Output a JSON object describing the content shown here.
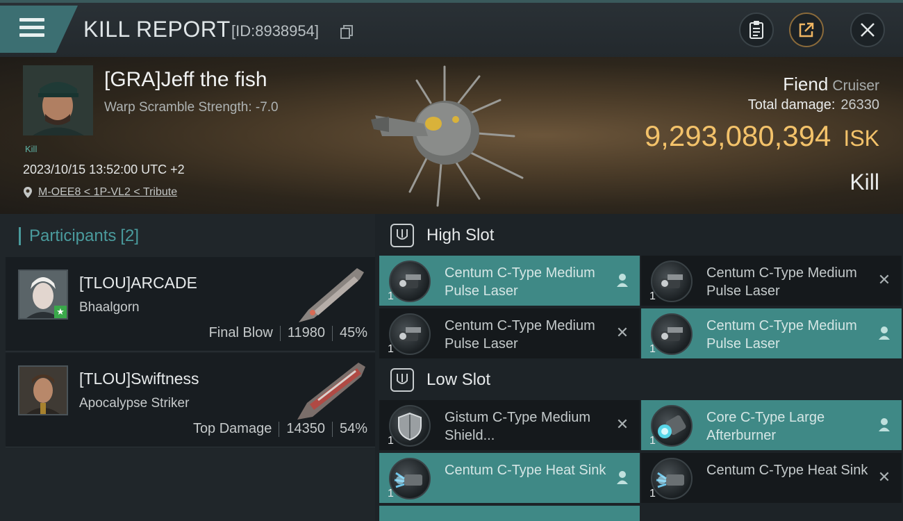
{
  "header": {
    "title": "KILL REPORT",
    "report_id": "[ID:8938954]"
  },
  "victim": {
    "name": "[GRA]Jeff the fish",
    "warp_scramble": "Warp Scramble Strength: -7.0",
    "tag": "Kill",
    "datetime": "2023/10/15 13:52:00 UTC +2",
    "location": "M-OEE8 < 1P-VL2 < Tribute"
  },
  "ship": {
    "name": "Fiend",
    "class": "Cruiser",
    "total_damage_label": "Total damage:",
    "total_damage": "26330",
    "isk_value": "9,293,080,394",
    "isk_currency": "ISK",
    "result": "Kill"
  },
  "participants": {
    "label": "Participants",
    "count": "[2]",
    "list": [
      {
        "name": "[TLOU]ARCADE",
        "ship": "Bhaalgorn",
        "role": "Final Blow",
        "damage": "11980",
        "percent": "45%"
      },
      {
        "name": "[TLOU]Swiftness",
        "ship": "Apocalypse Striker",
        "role": "Top Damage",
        "damage": "14350",
        "percent": "54%"
      }
    ]
  },
  "slots": {
    "high": {
      "label": "High Slot",
      "modules": [
        {
          "name": "Centum C-Type Medium Pulse Laser",
          "qty": "1",
          "state": "active"
        },
        {
          "name": "Centum C-Type Medium Pulse Laser",
          "qty": "1",
          "state": "destroyed"
        },
        {
          "name": "Centum C-Type Medium Pulse Laser",
          "qty": "1",
          "state": "destroyed"
        },
        {
          "name": "Centum C-Type Medium Pulse Laser",
          "qty": "1",
          "state": "active"
        }
      ]
    },
    "low": {
      "label": "Low Slot",
      "modules": [
        {
          "name": "Gistum C-Type Medium Shield...",
          "qty": "1",
          "state": "destroyed"
        },
        {
          "name": "Core C-Type Large Afterburner",
          "qty": "1",
          "state": "active"
        },
        {
          "name": "Centum C-Type Heat Sink",
          "qty": "1",
          "state": "active"
        },
        {
          "name": "Centum C-Type Heat Sink",
          "qty": "1",
          "state": "destroyed"
        }
      ]
    }
  },
  "icons": {
    "menu": "hamburger-icon",
    "copy": "copy-icon",
    "clipboard": "clipboard-icon",
    "share": "share-icon",
    "close": "close-icon",
    "location": "location-pin-icon",
    "pilot": "pilot-icon",
    "destroyed": "x-icon"
  },
  "colors": {
    "accent": "#3f8986",
    "isk": "#f3c26a",
    "participants_label": "#4a9b9d"
  }
}
